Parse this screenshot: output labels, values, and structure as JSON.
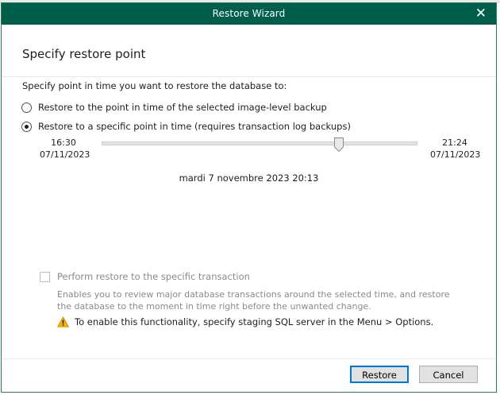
{
  "window": {
    "title": "Restore Wizard"
  },
  "page": {
    "heading": "Specify restore point",
    "prompt": "Specify point in time you want to restore the database to:"
  },
  "options": [
    {
      "label": "Restore to the point in time of the selected image-level backup",
      "selected": false
    },
    {
      "label": "Restore to a specific point in time (requires transaction log backups)",
      "selected": true
    }
  ],
  "timeline": {
    "start_time": "16:30",
    "start_date": "07/11/2023",
    "end_time": "21:24",
    "end_date": "07/11/2023",
    "position_fraction": 0.77,
    "selected_datetime": "mardi 7 novembre 2023 20:13"
  },
  "transaction": {
    "checkbox_label": "Perform restore to the specific transaction",
    "checked": false,
    "enabled": false,
    "description": "Enables you to review major database transactions around the selected time, and restore the database to the moment in time right before the unwanted change.",
    "warning": "To enable this functionality, specify staging SQL server in the Menu > Options."
  },
  "buttons": {
    "restore": "Restore",
    "cancel": "Cancel"
  },
  "colors": {
    "titlebar": "#005f4b",
    "warning": "#f2b200"
  }
}
